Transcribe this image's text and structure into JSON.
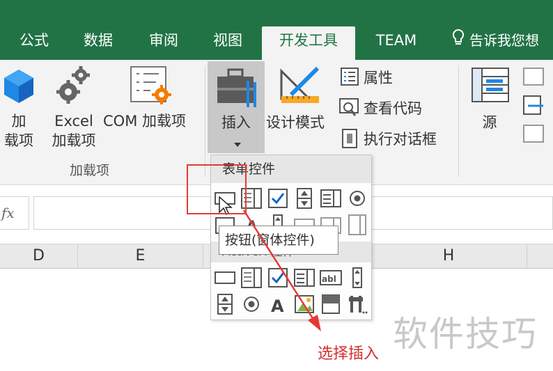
{
  "tabs": [
    {
      "label": "公式"
    },
    {
      "label": "数据"
    },
    {
      "label": "审阅"
    },
    {
      "label": "视图"
    },
    {
      "label": "开发工具"
    },
    {
      "label": "TEAM"
    }
  ],
  "tell_me": "告诉我您想",
  "ribbon": {
    "addins": {
      "addin_label": "加\n载项",
      "excel_addin_label": "Excel\n加载项",
      "com_addin_label": "COM 加载项",
      "group_label": "加载项"
    },
    "controls": {
      "insert_label": "插入",
      "design_mode_label": "设计模式",
      "properties_label": "属性",
      "view_code_label": "查看代码",
      "run_dialog_label": "执行对话框"
    },
    "xml": {
      "source_label": "源"
    }
  },
  "formula_bar": {
    "fx": "fx"
  },
  "columns": [
    "D",
    "E",
    "H"
  ],
  "dropdown": {
    "form_controls_header": "表单控件",
    "activex_header": "ActiveX 控件"
  },
  "tooltip": "按钮(窗体控件)",
  "annotation": "选择插入",
  "watermark": "软件技巧",
  "colors": {
    "excel_green": "#217346",
    "annotation_red": "#e53935"
  }
}
